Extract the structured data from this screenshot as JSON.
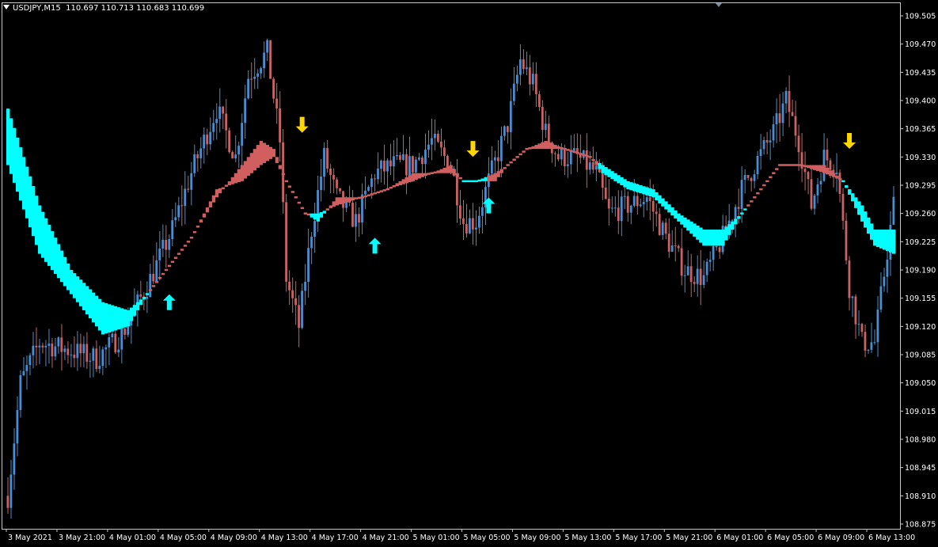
{
  "header": {
    "symbol_timeframe": "USDJPY,M15",
    "ohlc": "110.697 110.713 110.683 110.699"
  },
  "colors": {
    "background": "#000000",
    "frame": "#c8c8c8",
    "bull_candle": "#4a8ed0",
    "bear_candle": "#c86464",
    "band_up": "#00ffff",
    "band_down": "#d25f5f",
    "arrow_up": "#00ffff",
    "arrow_down": "#ffd700",
    "text": "#ffffff"
  },
  "chart_data": {
    "type": "candlestick",
    "grid": false,
    "y_ticks": [
      "109.505",
      "109.470",
      "109.435",
      "109.400",
      "109.365",
      "109.330",
      "109.295",
      "109.260",
      "109.225",
      "109.190",
      "109.155",
      "109.120",
      "109.085",
      "109.050",
      "109.015",
      "108.980",
      "108.945",
      "108.910",
      "108.875"
    ],
    "ylim": [
      108.87,
      109.51
    ],
    "x_ticks": [
      "3 May 2021",
      "3 May 21:00",
      "4 May 01:00",
      "4 May 05:00",
      "4 May 09:00",
      "4 May 13:00",
      "4 May 17:00",
      "4 May 21:00",
      "5 May 01:00",
      "5 May 05:00",
      "5 May 09:00",
      "5 May 13:00",
      "5 May 17:00",
      "5 May 21:00",
      "6 May 01:00",
      "6 May 05:00",
      "6 May 09:00",
      "6 May 13:00"
    ],
    "x_tick_index": [
      0,
      16,
      32,
      48,
      64,
      80,
      96,
      112,
      128,
      144,
      160,
      176,
      192,
      208,
      224,
      240,
      256,
      272
    ],
    "price_anchors": [
      [
        0,
        108.91
      ],
      [
        4,
        109.05
      ],
      [
        10,
        109.1
      ],
      [
        20,
        109.09
      ],
      [
        28,
        109.08
      ],
      [
        36,
        109.11
      ],
      [
        44,
        109.17
      ],
      [
        52,
        109.24
      ],
      [
        58,
        109.31
      ],
      [
        66,
        109.39
      ],
      [
        72,
        109.33
      ],
      [
        76,
        109.43
      ],
      [
        82,
        109.46
      ],
      [
        86,
        109.35
      ],
      [
        88,
        109.18
      ],
      [
        92,
        109.12
      ],
      [
        96,
        109.24
      ],
      [
        100,
        109.33
      ],
      [
        104,
        109.28
      ],
      [
        110,
        109.25
      ],
      [
        116,
        109.31
      ],
      [
        122,
        109.32
      ],
      [
        128,
        109.32
      ],
      [
        134,
        109.35
      ],
      [
        140,
        109.32
      ],
      [
        144,
        109.25
      ],
      [
        148,
        109.25
      ],
      [
        152,
        109.3
      ],
      [
        158,
        109.37
      ],
      [
        162,
        109.45
      ],
      [
        166,
        109.42
      ],
      [
        170,
        109.36
      ],
      [
        174,
        109.33
      ],
      [
        180,
        109.33
      ],
      [
        186,
        109.31
      ],
      [
        190,
        109.26
      ],
      [
        196,
        109.27
      ],
      [
        202,
        109.28
      ],
      [
        208,
        109.23
      ],
      [
        214,
        109.19
      ],
      [
        220,
        109.18
      ],
      [
        226,
        109.23
      ],
      [
        232,
        109.29
      ],
      [
        236,
        109.32
      ],
      [
        242,
        109.36
      ],
      [
        246,
        109.4
      ],
      [
        250,
        109.35
      ],
      [
        254,
        109.27
      ],
      [
        258,
        109.33
      ],
      [
        262,
        109.32
      ],
      [
        266,
        109.17
      ],
      [
        270,
        109.1
      ],
      [
        274,
        109.1
      ],
      [
        280,
        109.27
      ]
    ],
    "band_anchors": [
      [
        0,
        109.39,
        109.32
      ],
      [
        10,
        109.27,
        109.21
      ],
      [
        20,
        109.19,
        109.16
      ],
      [
        30,
        109.15,
        109.11
      ],
      [
        38,
        109.14,
        109.12
      ],
      [
        44,
        109.16,
        109.16
      ],
      [
        52,
        109.2,
        109.2
      ],
      [
        58,
        109.23,
        109.23
      ],
      [
        66,
        109.28,
        109.29
      ],
      [
        74,
        109.32,
        109.3
      ],
      [
        80,
        109.35,
        109.32
      ],
      [
        84,
        109.34,
        109.33
      ],
      [
        88,
        109.3,
        109.3
      ],
      [
        94,
        109.26,
        109.26
      ],
      [
        98,
        109.26,
        109.25
      ],
      [
        104,
        109.27,
        109.28
      ],
      [
        112,
        109.28,
        109.28
      ],
      [
        120,
        109.29,
        109.29
      ],
      [
        128,
        109.3,
        109.31
      ],
      [
        140,
        109.32,
        109.31
      ],
      [
        144,
        109.3,
        109.3
      ],
      [
        148,
        109.3,
        109.3
      ],
      [
        154,
        109.3,
        109.31
      ],
      [
        158,
        109.32,
        109.32
      ],
      [
        164,
        109.34,
        109.34
      ],
      [
        170,
        109.35,
        109.34
      ],
      [
        176,
        109.34,
        109.34
      ],
      [
        184,
        109.33,
        109.33
      ],
      [
        188,
        109.32,
        109.31
      ],
      [
        196,
        109.3,
        109.29
      ],
      [
        204,
        109.29,
        109.28
      ],
      [
        212,
        109.26,
        109.25
      ],
      [
        220,
        109.24,
        109.22
      ],
      [
        226,
        109.24,
        109.22
      ],
      [
        232,
        109.26,
        109.26
      ],
      [
        238,
        109.29,
        109.29
      ],
      [
        244,
        109.32,
        109.32
      ],
      [
        250,
        109.32,
        109.32
      ],
      [
        258,
        109.32,
        109.31
      ],
      [
        264,
        109.3,
        109.3
      ],
      [
        270,
        109.27,
        109.25
      ],
      [
        274,
        109.24,
        109.22
      ],
      [
        280,
        109.24,
        109.21
      ]
    ],
    "band_trend": [
      {
        "from": 0,
        "to": 45,
        "trend": "up"
      },
      {
        "from": 45,
        "to": 96,
        "trend": "down"
      },
      {
        "from": 96,
        "to": 101,
        "trend": "up"
      },
      {
        "from": 101,
        "to": 144,
        "trend": "down"
      },
      {
        "from": 144,
        "to": 152,
        "trend": "up"
      },
      {
        "from": 152,
        "to": 187,
        "trend": "down"
      },
      {
        "from": 187,
        "to": 234,
        "trend": "up"
      },
      {
        "from": 234,
        "to": 264,
        "trend": "down"
      },
      {
        "from": 264,
        "to": 281,
        "trend": "up"
      }
    ],
    "signals": [
      {
        "index": 51,
        "type": "buy",
        "price": 109.15
      },
      {
        "index": 93,
        "type": "sell",
        "price": 109.37
      },
      {
        "index": 116,
        "type": "buy",
        "price": 109.22
      },
      {
        "index": 147,
        "type": "sell",
        "price": 109.34
      },
      {
        "index": 152,
        "type": "buy",
        "price": 109.27
      },
      {
        "index": 266,
        "type": "sell",
        "price": 109.35
      }
    ]
  }
}
